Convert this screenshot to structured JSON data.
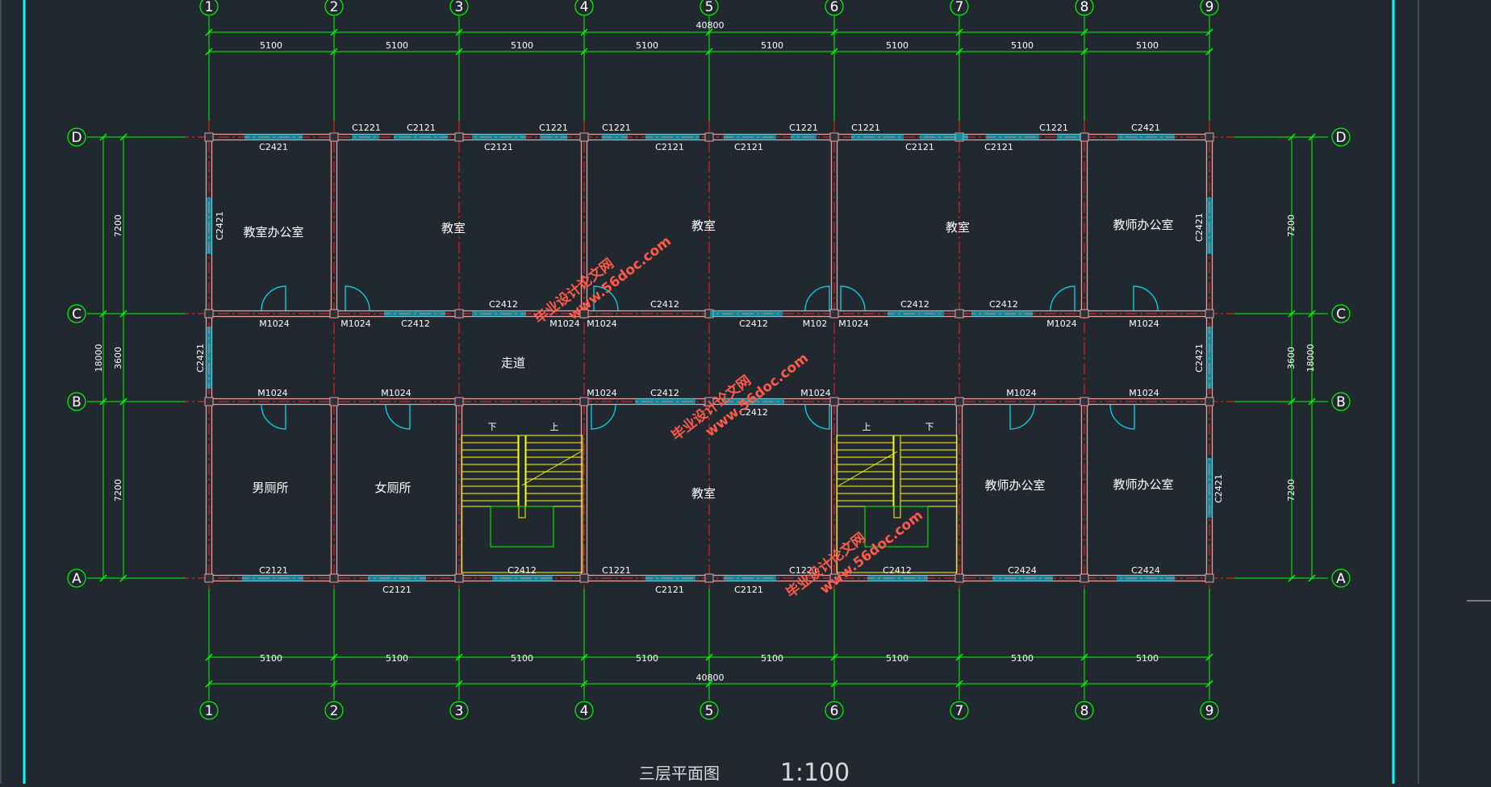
{
  "drawing": {
    "title": "三层平面图",
    "scale": "1:100",
    "colors": {
      "background": "#212830",
      "grid_line": "#00ff00",
      "axis_line": "#ff2020",
      "wall": "#e8a0a0",
      "window": "#00e5ff",
      "door": "#00e5ff",
      "stair": "#ffff00",
      "frame": "#00ffff"
    }
  },
  "axes": {
    "numbers": [
      "1",
      "2",
      "3",
      "4",
      "5",
      "6",
      "7",
      "8",
      "9"
    ],
    "letters": [
      "A",
      "B",
      "C",
      "D"
    ]
  },
  "dimensions": {
    "span": "5100",
    "total_x": "40800",
    "total_y": "18000",
    "bay_7200": "7200",
    "bay_3600": "3600"
  },
  "rooms": {
    "r1": "教室办公室",
    "r2": "教室",
    "r3": "教室",
    "r4": "教室",
    "r5": "教师办公室",
    "corridor": "走道",
    "r6": "男厕所",
    "r7": "女厕所",
    "r8": "教室",
    "r9": "教师办公室",
    "r10": "教师办公室",
    "stair_up": "上",
    "stair_down": "下"
  },
  "labels": {
    "C2421": "C2421",
    "C1221": "C1221",
    "C2121": "C2121",
    "C2412": "C2412",
    "C2424": "C2424",
    "M1024": "M1024",
    "M102_partial": "M102"
  },
  "watermark": {
    "line1": "毕业设计论文网",
    "line2": "www.56doc.com"
  }
}
